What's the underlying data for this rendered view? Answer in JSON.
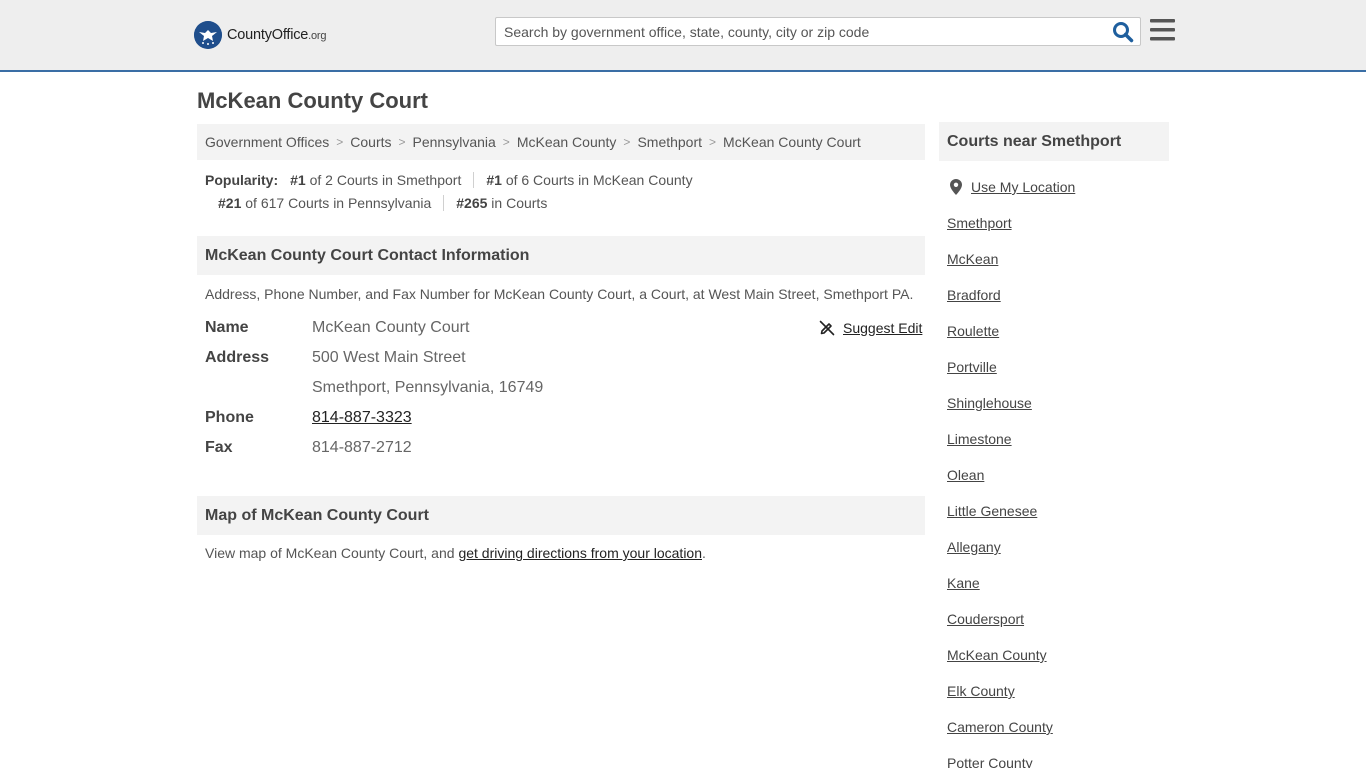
{
  "header": {
    "logo_main": "CountyOffice",
    "logo_tld": ".org",
    "search_placeholder": "Search by government office, state, county, city or zip code"
  },
  "page": {
    "title": "McKean County Court"
  },
  "breadcrumb": [
    "Government Offices",
    "Courts",
    "Pennsylvania",
    "McKean County",
    "Smethport",
    "McKean County Court"
  ],
  "popularity": {
    "label": "Popularity:",
    "items": [
      {
        "rank": "#1",
        "text": "of 2 Courts in Smethport"
      },
      {
        "rank": "#1",
        "text": "of 6 Courts in McKean County"
      },
      {
        "rank": "#21",
        "text": "of 617 Courts in Pennsylvania"
      },
      {
        "rank": "#265",
        "text": "in Courts"
      }
    ]
  },
  "contact": {
    "heading": "McKean County Court Contact Information",
    "description": "Address, Phone Number, and Fax Number for McKean County Court, a Court, at West Main Street, Smethport PA.",
    "suggest_edit": "Suggest Edit",
    "name_label": "Name",
    "name_value": "McKean County Court",
    "address_label": "Address",
    "address_line1": "500 West Main Street",
    "address_line2": "Smethport, Pennsylvania, 16749",
    "phone_label": "Phone",
    "phone_value": "814-887-3323",
    "fax_label": "Fax",
    "fax_value": "814-887-2712"
  },
  "map": {
    "heading": "Map of McKean County Court",
    "desc_prefix": "View map of McKean County Court, and ",
    "desc_link": "get driving directions from your location",
    "desc_suffix": "."
  },
  "sidebar": {
    "heading": "Courts near Smethport",
    "use_location": "Use My Location",
    "items": [
      "Smethport",
      "McKean",
      "Bradford",
      "Roulette",
      "Portville",
      "Shinglehouse",
      "Limestone",
      "Olean",
      "Little Genesee",
      "Allegany",
      "Kane",
      "Coudersport",
      "McKean County",
      "Elk County",
      "Cameron County",
      "Potter County"
    ]
  },
  "colors": {
    "header_bg": "#eeeeee",
    "header_border": "#3a6ea5",
    "search_icon": "#1f5f9e",
    "panel_bg": "#f3f3f3"
  }
}
